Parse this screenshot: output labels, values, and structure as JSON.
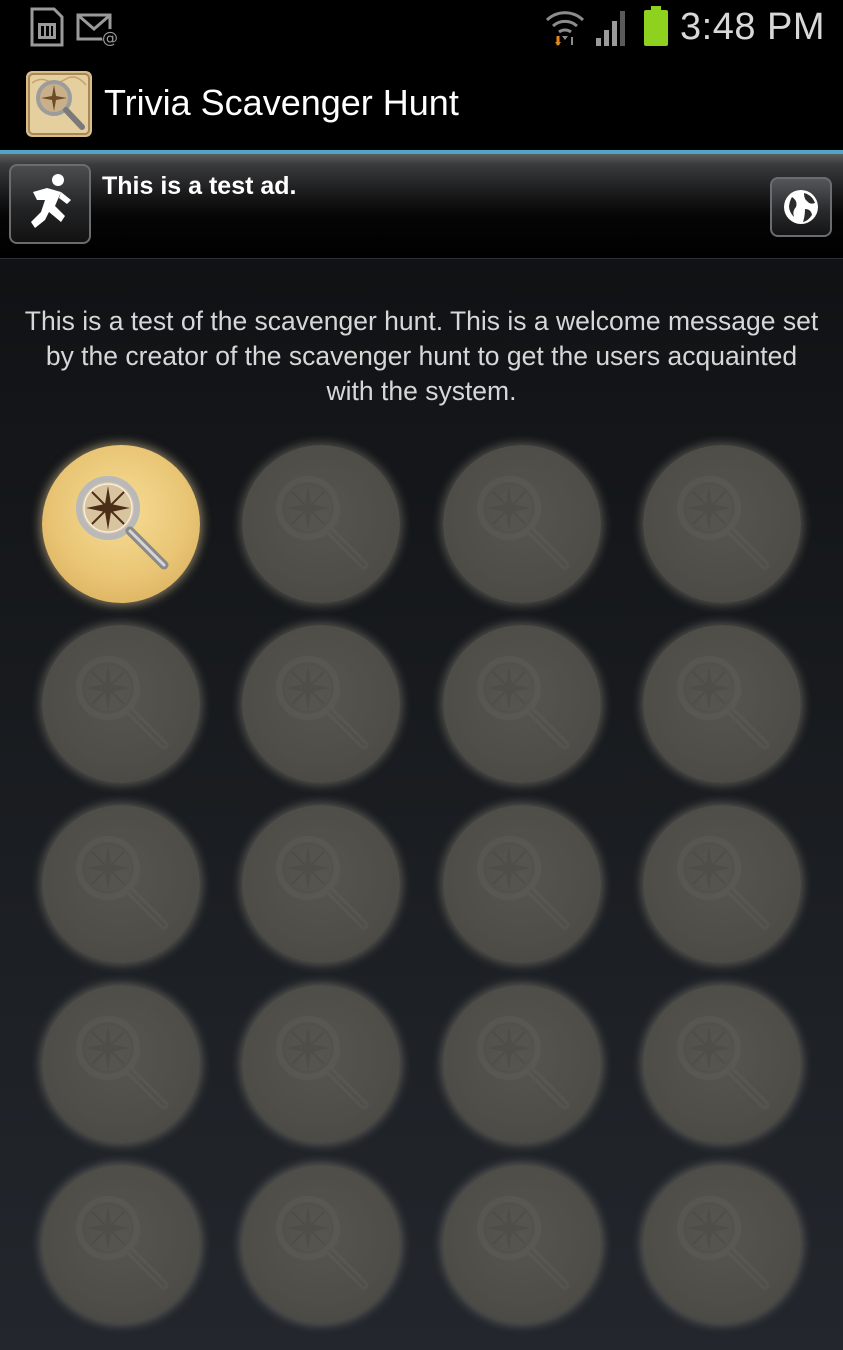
{
  "status_bar": {
    "time": "3:48 PM",
    "icons": [
      "sim-card-icon",
      "mail-icon",
      "wifi-icon",
      "signal-icon",
      "battery-icon"
    ],
    "battery_color": "#8ed21f"
  },
  "action_bar": {
    "title": "Trivia Scavenger Hunt",
    "icon": "magnifier-compass-icon",
    "divider_color": "#4ea7c9"
  },
  "ad": {
    "text": "This is a test ad.",
    "icon": "running-man-icon",
    "button_icon": "globe-icon"
  },
  "welcome_message": "This is a test of the scavenger hunt.  This is a welcome message set by the creator of the scavenger hunt to get the users acquainted with the system.",
  "hunt_items": [
    {
      "state": "unlocked"
    },
    {
      "state": "locked"
    },
    {
      "state": "locked"
    },
    {
      "state": "locked"
    },
    {
      "state": "locked"
    },
    {
      "state": "locked"
    },
    {
      "state": "locked"
    },
    {
      "state": "locked"
    },
    {
      "state": "locked"
    },
    {
      "state": "locked"
    },
    {
      "state": "locked"
    },
    {
      "state": "locked"
    },
    {
      "state": "locked"
    },
    {
      "state": "locked"
    },
    {
      "state": "locked"
    },
    {
      "state": "locked"
    },
    {
      "state": "locked"
    },
    {
      "state": "locked"
    },
    {
      "state": "locked"
    },
    {
      "state": "locked"
    }
  ],
  "colors": {
    "unlocked_fill": "#e9c575",
    "locked_fill": "#4f4d48"
  }
}
